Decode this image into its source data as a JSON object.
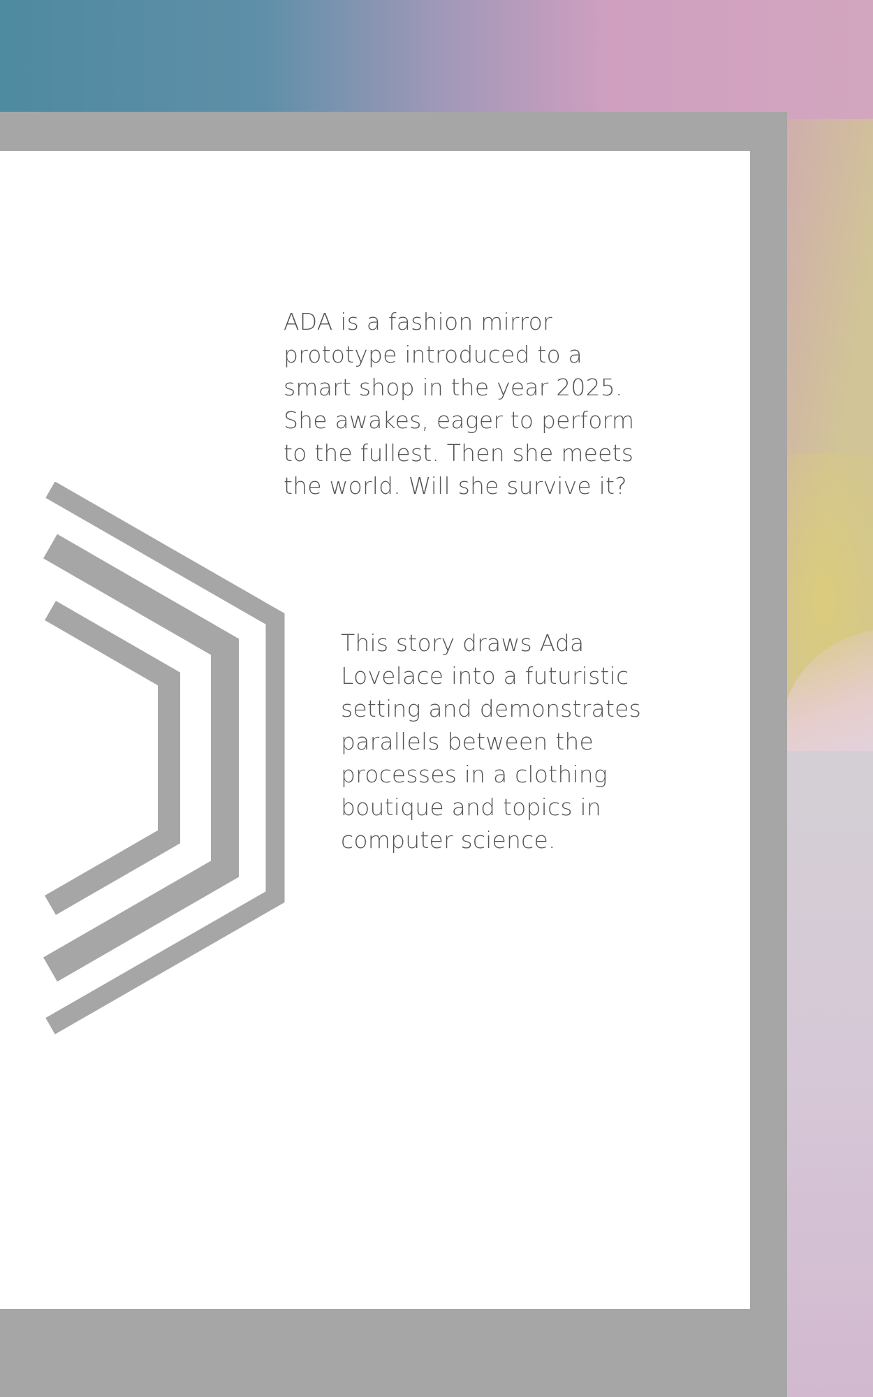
{
  "paragraphs": {
    "intro": "ADA is a fashion mirror\nprototype introduced to a\nsmart shop in the year 2025.\nShe awakes, eager to perform\nto the fullest. Then she meets\nthe world. Will she survive it?",
    "about": "This story draws Ada\nLovelace into a futuristic\nsetting and demonstrates\nparallels between the\nprocesses in a clothing\nboutique and topics in\ncomputer science."
  },
  "colors": {
    "frame": "#a6a6a6",
    "panel": "#ffffff",
    "text": "#555555",
    "chevron": "#a6a6a6"
  }
}
